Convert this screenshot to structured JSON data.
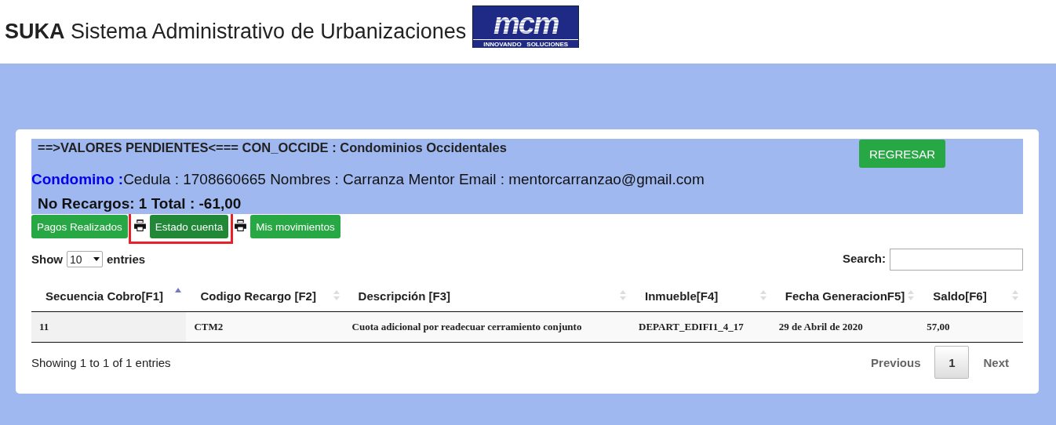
{
  "header": {
    "brand": "SUKA",
    "title": "Sistema Administrativo de Urbanizaciones",
    "logo": {
      "letters": "mcm",
      "tagline": "INNOVANDO   SOLUCIONES"
    }
  },
  "info": {
    "heading": "==>VALORES PENDIENTES<=== CON_OCCIDE : Condominios Occidentales",
    "back_button": "REGRESAR",
    "owner_label": "Condomino :",
    "owner_details": "Cedula : 1708660665 Nombres : Carranza Mentor Email : mentorcarranzao@gmail.com",
    "summary": "No Recargos: 1 Total : -61,00"
  },
  "actions": [
    {
      "label": "Pagos Realizados",
      "print_icon_before": false,
      "selected": false,
      "highlighted": false
    },
    {
      "label": "Estado cuenta",
      "print_icon_before": true,
      "selected": true,
      "highlighted": true
    },
    {
      "label": "Mis movimientos",
      "print_icon_before": true,
      "selected": false,
      "highlighted": false
    }
  ],
  "length": {
    "before": "Show",
    "value": "10",
    "after": "entries"
  },
  "search": {
    "label": "Search:"
  },
  "table": {
    "columns": [
      {
        "label": "Secuencia Cobro[F1]",
        "sorted": true
      },
      {
        "label": "Codigo Recargo [F2]",
        "sorted": false
      },
      {
        "label": "Descripción [F3]",
        "sorted": false
      },
      {
        "label": "Inmueble[F4]",
        "sorted": false
      },
      {
        "label": "Fecha GeneracionF5]",
        "sorted": false
      },
      {
        "label": "Saldo[F6]",
        "sorted": false
      }
    ],
    "rows": [
      [
        "11",
        "CTM2",
        "Cuota adicional por readecuar cerramiento conjunto",
        "DEPART_EDIFI1_4_17",
        "29 de Abril de 2020",
        "57,00"
      ]
    ]
  },
  "footer": {
    "info": "Showing 1 to 1 of 1 entries",
    "previous": "Previous",
    "pages": [
      {
        "label": "1",
        "selected": true
      }
    ],
    "next": "Next"
  }
}
